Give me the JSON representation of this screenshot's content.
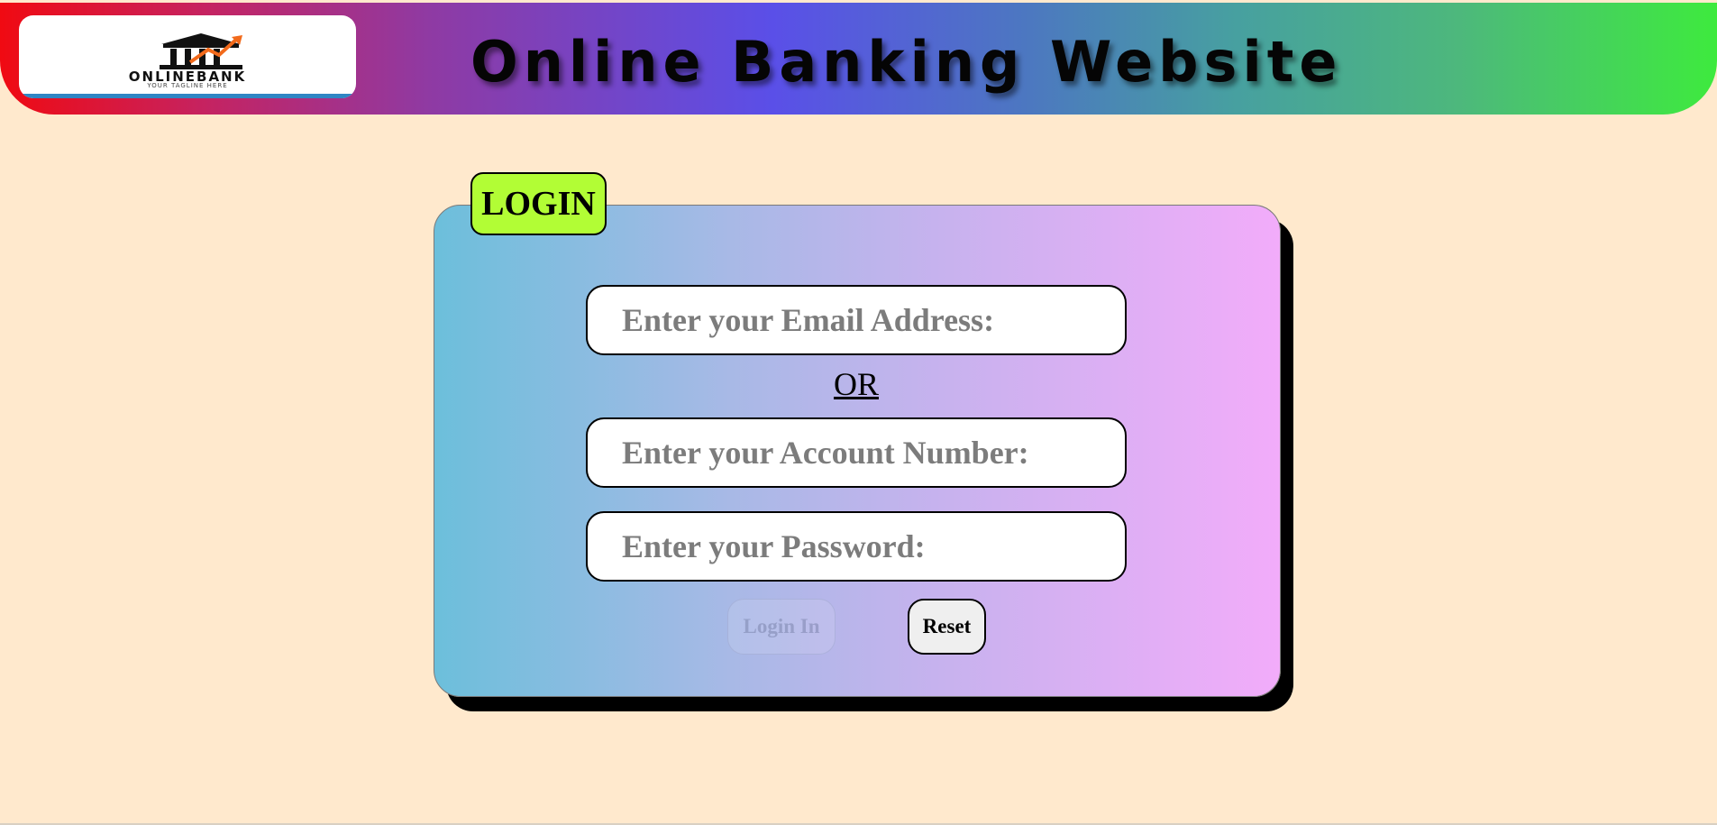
{
  "header": {
    "title": "Online Banking Website",
    "gradient_colors": [
      "#f00a12",
      "#5a4fe8",
      "#3eea3e"
    ],
    "logo": {
      "name": "ONLINEBANK",
      "tagline": "YOUR TAGLINE HERE",
      "icon": "bank-building-icon"
    }
  },
  "login": {
    "badge_label": "LOGIN",
    "badge_color": "#b2fd35",
    "email_placeholder": "Enter your Email Address:",
    "or_label": "OR",
    "account_placeholder": "Enter your Account Number:",
    "password_placeholder": "Enter your Password:",
    "login_button": "Login In",
    "reset_button": "Reset"
  },
  "colors": {
    "page_background": "#ffe9cd",
    "card_gradient_start": "#6cbfdb",
    "card_gradient_end": "#f2acfa"
  }
}
